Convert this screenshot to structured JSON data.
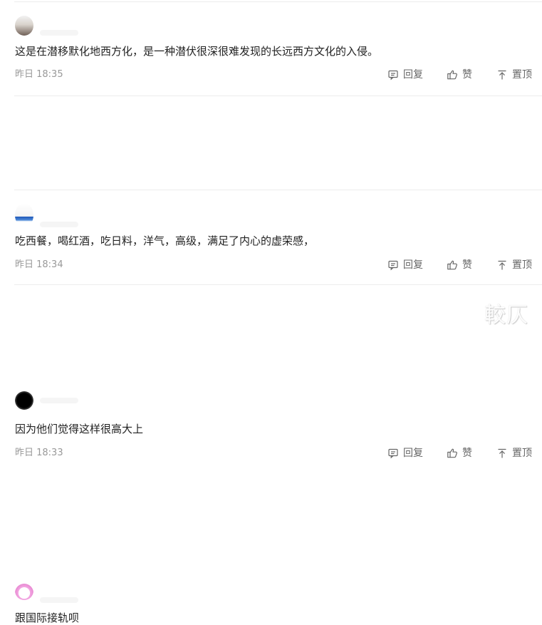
{
  "comments": [
    {
      "text": "这是在潜移默化地西方化，是一种潜伏很深很难发现的长远西方文化的入侵。",
      "time": "昨日 18:35",
      "actions": {
        "reply": "回复",
        "like": "赞",
        "pin": "置顶"
      }
    },
    {
      "text": "吃西餐，喝红酒，吃日料，洋气，高级，满足了内心的虚荣感，",
      "time": "昨日 18:34",
      "actions": {
        "reply": "回复",
        "like": "赞",
        "pin": "置顶"
      }
    },
    {
      "text": "因为他们觉得这样很高大上",
      "time": "昨日 18:33",
      "actions": {
        "reply": "回复",
        "like": "赞",
        "pin": "置顶"
      }
    },
    {
      "text": "跟国际接轨呗"
    }
  ],
  "watermark": "較仄",
  "icons": {
    "reply": "comment-icon",
    "like": "thumbs-up-icon",
    "pin": "pin-top-icon"
  },
  "colors": {
    "text": "#222222",
    "meta": "#999999",
    "actions": "#666666",
    "divider": "#ececec"
  }
}
